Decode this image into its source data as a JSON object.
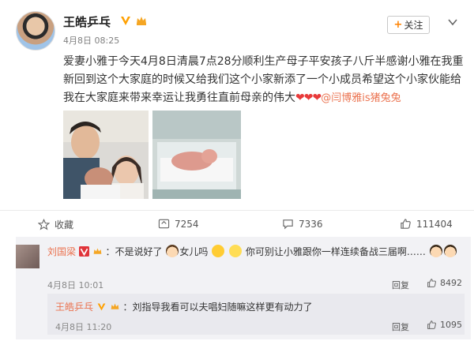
{
  "post": {
    "username": "王皓乒乓",
    "time": "4月8日 08:25",
    "text_main": "爱妻小雅于今天4月8日清晨7点28分顺利生产母子平安孩子八斤半感谢小雅在我重新回到这个大家庭的时候又给我们这个小家新添了一个小成员希望这个小家伙能给我在大家庭来带来幸运让我勇往直前母亲的伟大",
    "hearts": "❤❤❤",
    "mention": "@闫博雅is猪兔兔",
    "follow_label": "关注",
    "follow_plus": "+"
  },
  "actions": {
    "favorite_label": "收藏",
    "repost_count": "7254",
    "comment_count": "7336",
    "like_count": "111404"
  },
  "comments": [
    {
      "name": "刘国梁",
      "text_a": "：不是说好了",
      "text_b": "女儿吗",
      "text_c": "你可别让小雅跟你一样连续备战三届啊……",
      "time": "4月8日 10:01",
      "reply_label": "回复",
      "likes": "8492"
    },
    {
      "name": "王皓乒乓",
      "text": "：刘指导我看可以夫唱妇随嘛这样更有动力了",
      "time": "4月8日 11:20",
      "reply_label": "回复",
      "likes": "1095"
    }
  ],
  "colors": {
    "accent": "#ff8200",
    "link": "#eb7350",
    "heart": "#e83a3a",
    "comment_bg": "#f2f2f5"
  }
}
